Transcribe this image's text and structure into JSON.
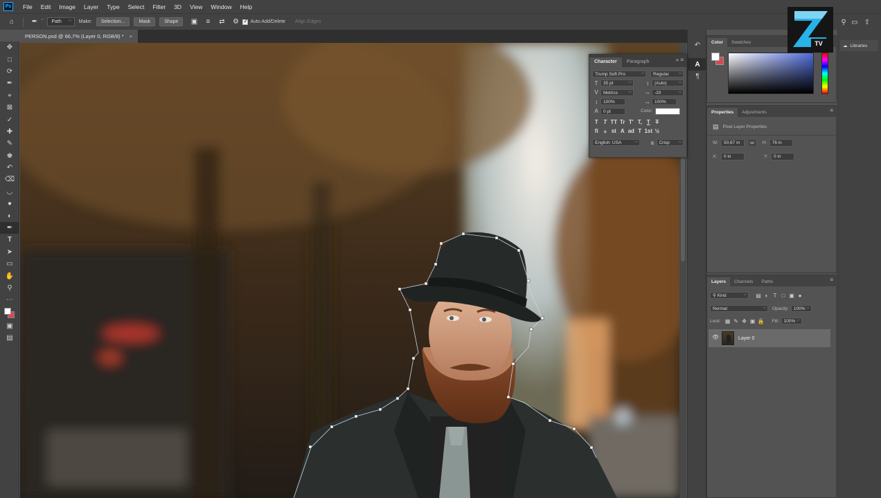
{
  "app": {
    "logo": "Ps"
  },
  "menu": [
    "File",
    "Edit",
    "Image",
    "Layer",
    "Type",
    "Select",
    "Filter",
    "3D",
    "View",
    "Window",
    "Help"
  ],
  "options": {
    "mode": "Path",
    "make_label": "Make:",
    "selection_btn": "Selection...",
    "mask_btn": "Mask",
    "shape_btn": "Shape",
    "auto_add_delete": "Auto Add/Delete",
    "align_edges": "Align Edges"
  },
  "doc_tab": {
    "title": "PERSON.psd @ 66,7% (Layer 0, RGB/8) *",
    "close": "×"
  },
  "character": {
    "tabs": [
      "Character",
      "Paragraph"
    ],
    "font_family": "Trump Soft Pro",
    "font_style": "Regular",
    "size": "35 pt",
    "leading": "(Auto)",
    "kerning": "Metrics",
    "tracking": "-20",
    "vscale": "100%",
    "hscale": "100%",
    "baseline": "0 pt",
    "color_label": "Color:",
    "language": "English: USA",
    "antialias": "Crisp",
    "glyphs": [
      "T",
      "T",
      "TT",
      "Tr",
      "T'",
      "T,",
      "T",
      "T"
    ],
    "opentype": [
      "fi",
      "ℴ",
      "st",
      "A",
      "ad",
      "T",
      "1st",
      "½"
    ]
  },
  "color_panel": {
    "tabs": [
      "Color",
      "Swatches"
    ]
  },
  "properties": {
    "tabs": [
      "Properties",
      "Adjustments"
    ],
    "section": "Pixel Layer Properties",
    "w_label": "W:",
    "w": "50,67 in",
    "h_label": "H:",
    "h": "76 in",
    "x_label": "X:",
    "x": "0 in",
    "y_label": "Y:",
    "y": "0 in"
  },
  "layers": {
    "tabs": [
      "Layers",
      "Channels",
      "Paths"
    ],
    "filter": "Kind",
    "blend": "Normal",
    "opacity_label": "Opacity:",
    "opacity": "100%",
    "lock_label": "Lock:",
    "fill_label": "Fill:",
    "fill": "100%",
    "layer_name": "Layer 0"
  },
  "libraries": "Libraries",
  "watermark": {
    "text": "Z",
    "sub": "TV"
  }
}
